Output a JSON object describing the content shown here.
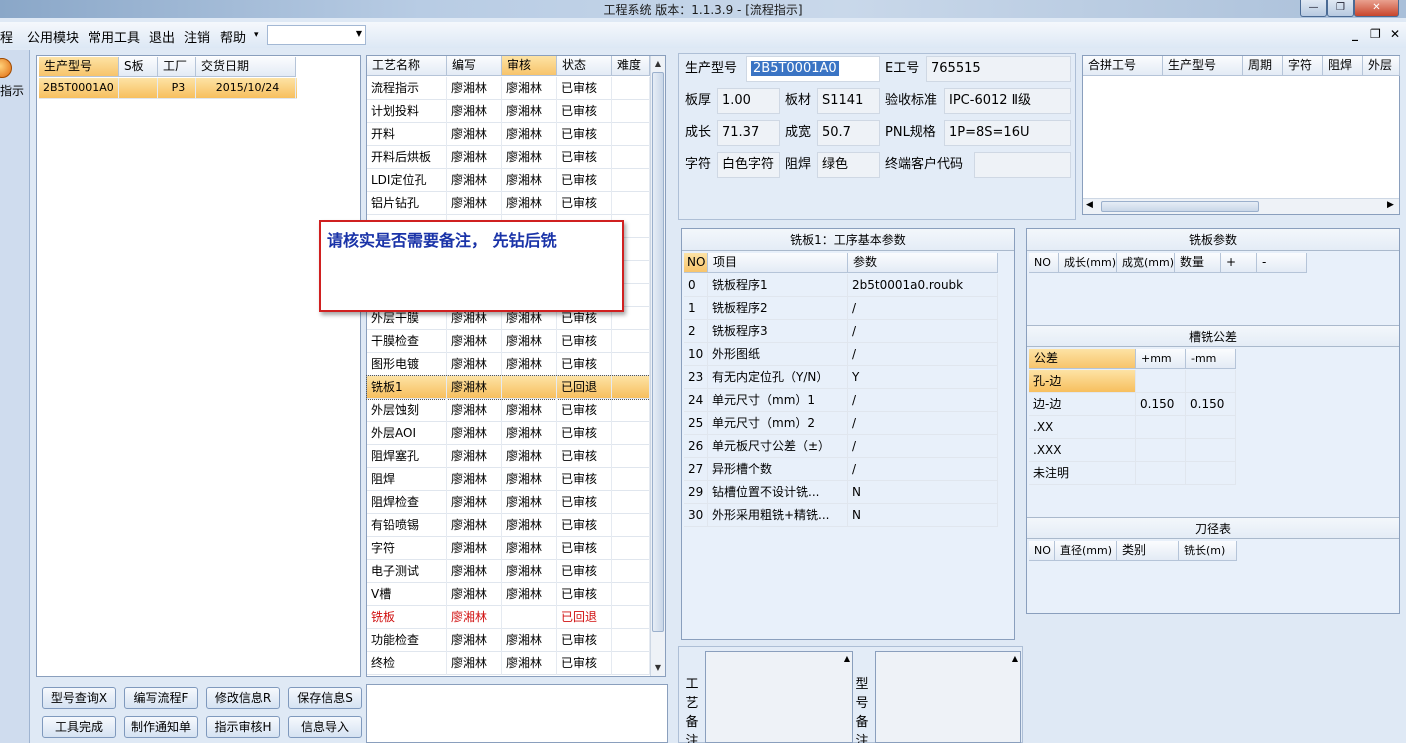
{
  "title": "工程系统   版本：1.1.3.9 - [流程指示]",
  "window_buttons": {
    "minimize": "—",
    "restore": "❐",
    "close": "✕"
  },
  "mdi_buttons": {
    "minimize": "_",
    "restore": "❐",
    "close": "✕"
  },
  "menu": {
    "items": [
      "程",
      "公用模块",
      "常用工具",
      "退出",
      "注销",
      "帮助"
    ],
    "help_arrow": "▾",
    "combo_value": ""
  },
  "left_strip": {
    "label": "指示"
  },
  "orders": {
    "columns": [
      "生产型号",
      "S板",
      "工厂",
      "交货日期"
    ],
    "rows": [
      {
        "model": "2B5T0001A0",
        "s": "",
        "factory": "P3",
        "date": "2015/10/24"
      }
    ]
  },
  "process": {
    "columns": [
      "工艺名称",
      "编写",
      "审核",
      "状态",
      "难度"
    ],
    "rows": [
      {
        "name": "流程指示",
        "writer": "廖湘林",
        "reviewer": "廖湘林",
        "status": "已审核",
        "state": ""
      },
      {
        "name": "计划投料",
        "writer": "廖湘林",
        "reviewer": "廖湘林",
        "status": "已审核",
        "state": ""
      },
      {
        "name": "开料",
        "writer": "廖湘林",
        "reviewer": "廖湘林",
        "status": "已审核",
        "state": ""
      },
      {
        "name": "开料后烘板",
        "writer": "廖湘林",
        "reviewer": "廖湘林",
        "status": "已审核",
        "state": ""
      },
      {
        "name": "LDI定位孔",
        "writer": "廖湘林",
        "reviewer": "廖湘林",
        "status": "已审核",
        "state": ""
      },
      {
        "name": "铝片钻孔",
        "writer": "廖湘林",
        "reviewer": "廖湘林",
        "status": "已审核",
        "state": ""
      },
      {
        "name": "",
        "writer": "",
        "reviewer": "",
        "status": "",
        "state": ""
      },
      {
        "name": "",
        "writer": "",
        "reviewer": "",
        "status": "",
        "state": ""
      },
      {
        "name": "",
        "writer": "",
        "reviewer": "",
        "status": "",
        "state": ""
      },
      {
        "name": "",
        "writer": "",
        "reviewer": "",
        "status": "",
        "state": ""
      },
      {
        "name": "外层干膜",
        "writer": "廖湘林",
        "reviewer": "廖湘林",
        "status": "已审核",
        "state": ""
      },
      {
        "name": "干膜检查",
        "writer": "廖湘林",
        "reviewer": "廖湘林",
        "status": "已审核",
        "state": ""
      },
      {
        "name": "图形电镀",
        "writer": "廖湘林",
        "reviewer": "廖湘林",
        "status": "已审核",
        "state": ""
      },
      {
        "name": "铣板1",
        "writer": "廖湘林",
        "reviewer": "",
        "status": "已回退",
        "state": "selected"
      },
      {
        "name": "外层蚀刻",
        "writer": "廖湘林",
        "reviewer": "廖湘林",
        "status": "已审核",
        "state": ""
      },
      {
        "name": "外层AOI",
        "writer": "廖湘林",
        "reviewer": "廖湘林",
        "status": "已审核",
        "state": ""
      },
      {
        "name": "阻焊塞孔",
        "writer": "廖湘林",
        "reviewer": "廖湘林",
        "status": "已审核",
        "state": ""
      },
      {
        "name": "阻焊",
        "writer": "廖湘林",
        "reviewer": "廖湘林",
        "status": "已审核",
        "state": ""
      },
      {
        "name": "阻焊检查",
        "writer": "廖湘林",
        "reviewer": "廖湘林",
        "status": "已审核",
        "state": ""
      },
      {
        "name": "有铅喷锡",
        "writer": "廖湘林",
        "reviewer": "廖湘林",
        "status": "已审核",
        "state": ""
      },
      {
        "name": "字符",
        "writer": "廖湘林",
        "reviewer": "廖湘林",
        "status": "已审核",
        "state": ""
      },
      {
        "name": "电子测试",
        "writer": "廖湘林",
        "reviewer": "廖湘林",
        "status": "已审核",
        "state": ""
      },
      {
        "name": "V槽",
        "writer": "廖湘林",
        "reviewer": "廖湘林",
        "status": "已审核",
        "state": ""
      },
      {
        "name": "铣板",
        "writer": "廖湘林",
        "reviewer": "",
        "status": "已回退",
        "state": "returned"
      },
      {
        "name": "功能检查",
        "writer": "廖湘林",
        "reviewer": "廖湘林",
        "status": "已审核",
        "state": ""
      },
      {
        "name": "终检",
        "writer": "廖湘林",
        "reviewer": "廖湘林",
        "status": "已审核",
        "state": ""
      }
    ]
  },
  "popup": {
    "text": "请核实是否需要备注， 先钻后铣"
  },
  "info": {
    "model_label": "生产型号",
    "model_value": "2B5T0001A0",
    "e_label": "E工号",
    "e_value": "765515",
    "thickness_label": "板厚",
    "thickness_value": "1.00",
    "material_label": "板材",
    "material_value": "S1141",
    "standard_label": "验收标准",
    "standard_value": "IPC-6012 Ⅱ级",
    "length_label": "成长",
    "length_value": "71.37",
    "width_label": "成宽",
    "width_value": "50.7",
    "pnl_label": "PNL规格",
    "pnl_value": "1P=8S=16U",
    "char_label": "字符",
    "char_value": "白色字符",
    "mask_label": "阻焊",
    "mask_value": "绿色",
    "customer_label": "终端客户代码",
    "customer_value": ""
  },
  "combined": {
    "columns": [
      "合拼工号",
      "生产型号",
      "周期",
      "字符",
      "阻焊",
      "外层"
    ]
  },
  "milling": {
    "title": "铣板1：工序基本参数",
    "columns": [
      "NO",
      "项目",
      "参数"
    ],
    "rows": [
      {
        "no": "0",
        "item": "铣板程序1",
        "param": "2b5t0001a0.roubk"
      },
      {
        "no": "1",
        "item": "铣板程序2",
        "param": "/"
      },
      {
        "no": "2",
        "item": "铣板程序3",
        "param": "/"
      },
      {
        "no": "10",
        "item": "外形图纸",
        "param": "/"
      },
      {
        "no": "23",
        "item": "有无内定位孔（Y/N）",
        "param": "Y"
      },
      {
        "no": "24",
        "item": "单元尺寸（mm）1",
        "param": "/"
      },
      {
        "no": "25",
        "item": "单元尺寸（mm）2",
        "param": "/"
      },
      {
        "no": "26",
        "item": "单元板尺寸公差（±）",
        "param": "/"
      },
      {
        "no": "27",
        "item": "异形槽个数",
        "param": "/"
      },
      {
        "no": "29",
        "item": "钻槽位置不设计铣...",
        "param": "N"
      },
      {
        "no": "30",
        "item": "外形采用粗铣+精铣...",
        "param": "N"
      }
    ]
  },
  "board_params": {
    "title": "铣板参数",
    "columns": [
      "NO",
      "成长(mm)",
      "成宽(mm)",
      "数量",
      "+",
      "-"
    ]
  },
  "tolerance": {
    "title": "槽铣公差",
    "columns": [
      "公差",
      "+mm",
      "-mm"
    ],
    "rows": [
      {
        "name": "孔-边",
        "plus": "",
        "minus": "",
        "state": "selected"
      },
      {
        "name": "边-边",
        "plus": "0.150",
        "minus": "0.150",
        "state": ""
      },
      {
        "name": ".XX",
        "plus": "",
        "minus": "",
        "state": ""
      },
      {
        "name": ".XXX",
        "plus": "",
        "minus": "",
        "state": ""
      },
      {
        "name": "未注明",
        "plus": "",
        "minus": "",
        "state": ""
      }
    ]
  },
  "tools": {
    "title": "刀径表",
    "columns": [
      "NO",
      "直径(mm)",
      "类别",
      "铣长(m)"
    ]
  },
  "buttons": {
    "model_query": "型号查询X",
    "write_flow": "编写流程F",
    "modify_info": "修改信息R",
    "save_info": "保存信息S",
    "tool_done": "工具完成",
    "make_notice": "制作通知单",
    "review": "指示审核H",
    "import_info": "信息导入"
  },
  "notes": {
    "process_label": "工艺备注",
    "model_label": "型号备注"
  }
}
